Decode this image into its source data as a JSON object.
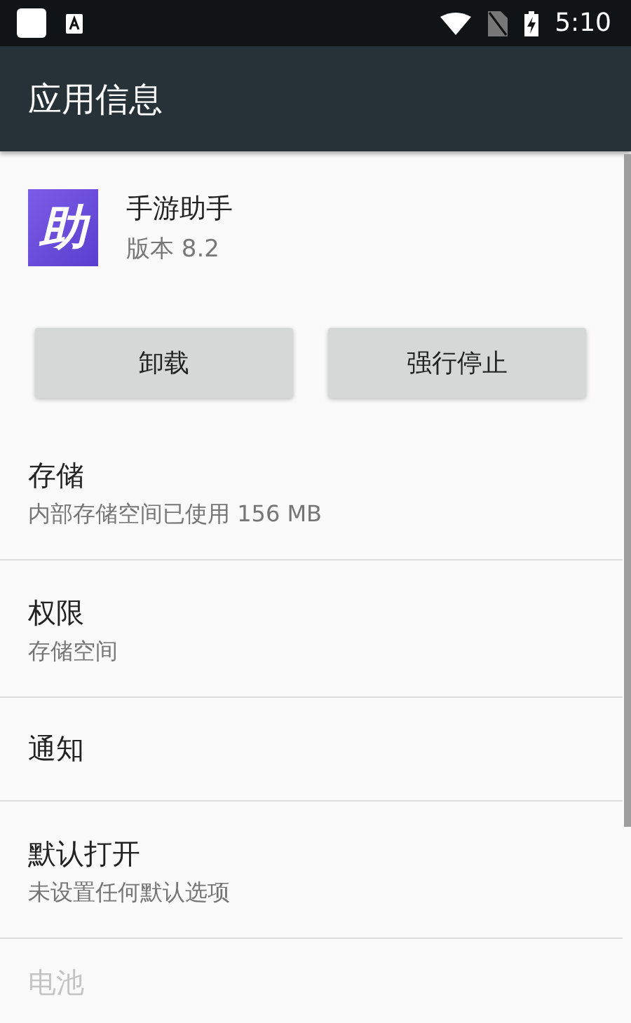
{
  "status_bar": {
    "time": "5:10"
  },
  "app_bar": {
    "title": "应用信息"
  },
  "app": {
    "name": "手游助手",
    "version": "版本 8.2",
    "icon_glyph": "助"
  },
  "buttons": [
    {
      "label": "卸载",
      "disabled": false
    },
    {
      "label": "强行停止",
      "disabled": false
    }
  ],
  "settings": [
    {
      "title": "存储",
      "summary": "内部存储空间已使用 156 MB",
      "disabled": false
    },
    {
      "title": "权限",
      "summary": "存储空间",
      "disabled": false
    },
    {
      "title": "通知",
      "disabled": false
    },
    {
      "title": "默认打开",
      "summary": "未设置任何默认选项",
      "disabled": false
    },
    {
      "title": "电池",
      "disabled": true
    }
  ]
}
